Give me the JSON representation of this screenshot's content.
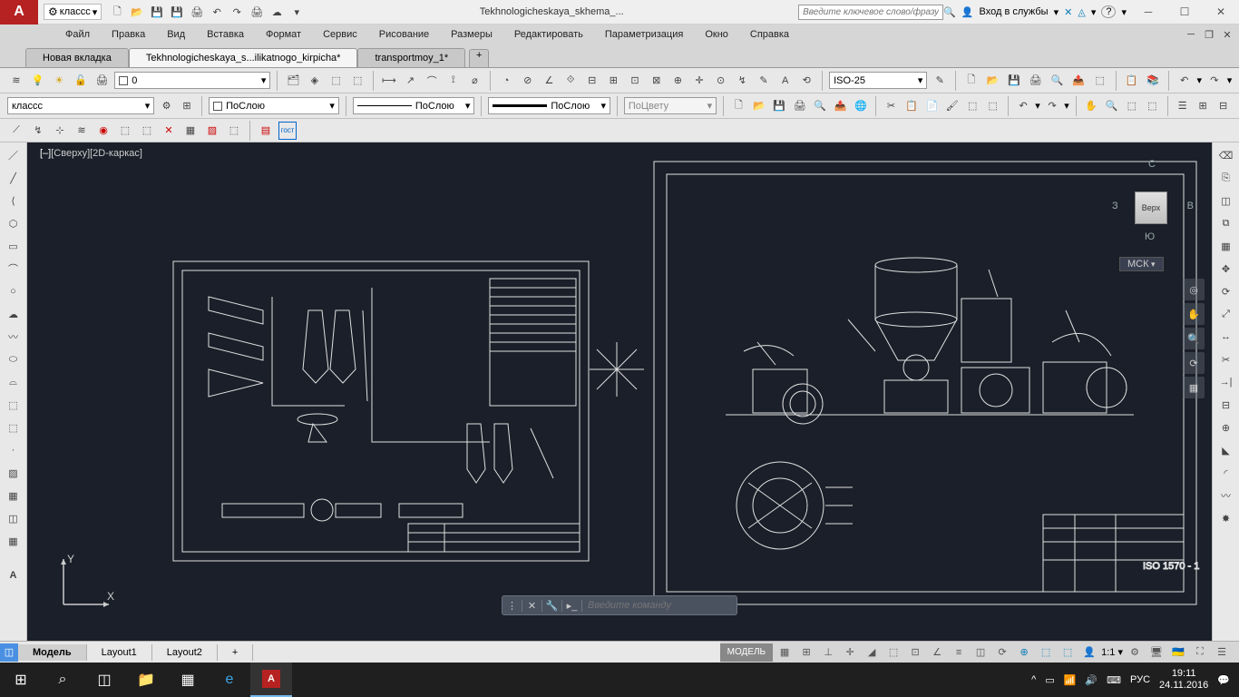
{
  "title_bar": {
    "workspace_combo": "классс",
    "doc_title": "Tekhnologicheskaya_skhema_...",
    "search_placeholder": "Введите ключевое слово/фразу",
    "login_label": "Вход в службы"
  },
  "menu": [
    "Файл",
    "Правка",
    "Вид",
    "Вставка",
    "Формат",
    "Сервис",
    "Рисование",
    "Размеры",
    "Редактировать",
    "Параметризация",
    "Окно",
    "Справка"
  ],
  "doc_tabs": {
    "items": [
      "Новая вкладка",
      "Tekhnologicheskaya_s...ilikatnogo_kirpicha*",
      "transportmoy_1*"
    ],
    "active": 1
  },
  "row2": {
    "layer_combo": "0",
    "dimstyle": "ISO-25"
  },
  "row3": {
    "style_combo": "классс",
    "linetype": "ПоСлою",
    "lineweight": "ПоСлою",
    "plotstyle": "ПоСлою",
    "color": "ПоЦвету"
  },
  "viewport": {
    "label1": "[–]",
    "label2": "[Сверху]",
    "label3": "[2D-каркас]",
    "viewcube_face": "Верх",
    "compass": {
      "n": "С",
      "s": "Ю",
      "e": "В",
      "w": "З"
    },
    "wcs": "МСК",
    "ucs_x": "X",
    "ucs_y": "Y"
  },
  "cmdline": {
    "placeholder": "Введите команду"
  },
  "layout_tabs": {
    "items": [
      "Модель",
      "Layout1",
      "Layout2"
    ],
    "active": 0
  },
  "status": {
    "model": "МОДЕЛЬ",
    "scale": "1:1"
  },
  "taskbar": {
    "lang": "РУС",
    "time": "19:11",
    "date": "24.11.2016"
  }
}
